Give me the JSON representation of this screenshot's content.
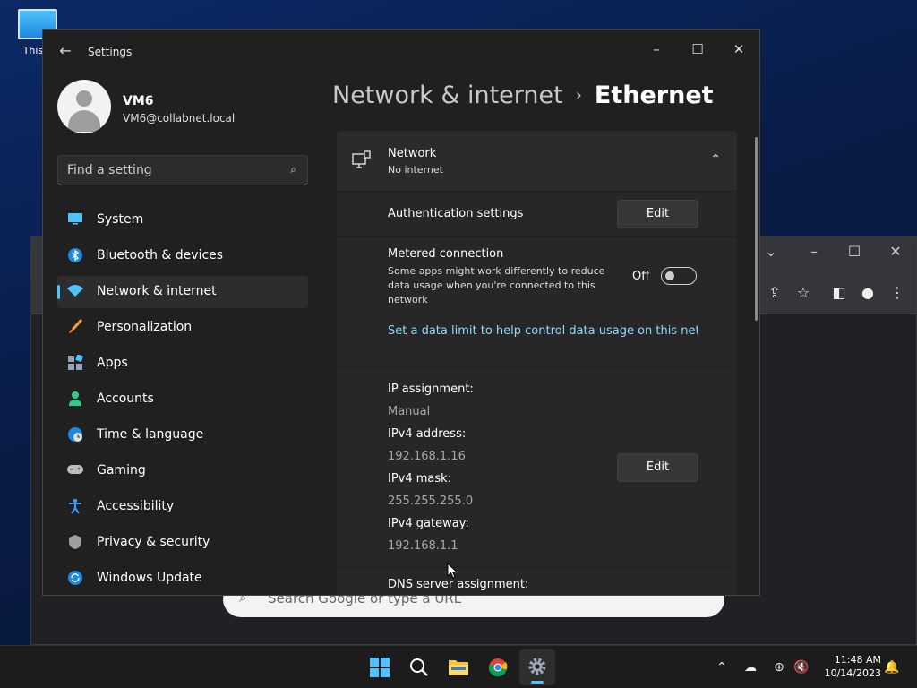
{
  "desktop": {
    "this_pc_label": "This P"
  },
  "browser": {
    "search_placeholder": "Search Google or type a URL"
  },
  "settings": {
    "app_title": "Settings",
    "user": {
      "name": "VM6",
      "email": "VM6@collabnet.local"
    },
    "search_placeholder": "Find a setting",
    "nav_items": [
      {
        "label": "System",
        "icon": "system-icon",
        "selected": false
      },
      {
        "label": "Bluetooth & devices",
        "icon": "bluetooth-icon",
        "selected": false
      },
      {
        "label": "Network & internet",
        "icon": "wifi-icon",
        "selected": true
      },
      {
        "label": "Personalization",
        "icon": "brush-icon",
        "selected": false
      },
      {
        "label": "Apps",
        "icon": "apps-icon",
        "selected": false
      },
      {
        "label": "Accounts",
        "icon": "person-icon",
        "selected": false
      },
      {
        "label": "Time & language",
        "icon": "globe-clock-icon",
        "selected": false
      },
      {
        "label": "Gaming",
        "icon": "gamepad-icon",
        "selected": false
      },
      {
        "label": "Accessibility",
        "icon": "accessibility-icon",
        "selected": false
      },
      {
        "label": "Privacy & security",
        "icon": "shield-icon",
        "selected": false
      },
      {
        "label": "Windows Update",
        "icon": "update-icon",
        "selected": false
      }
    ],
    "breadcrumb": {
      "parent": "Network & internet",
      "separator": "›",
      "current": "Ethernet"
    },
    "network": {
      "title": "Network",
      "status": "No internet"
    },
    "authentication": {
      "label": "Authentication settings",
      "button": "Edit"
    },
    "metered": {
      "title": "Metered connection",
      "description": "Some apps might work differently to reduce data usage when you're connected to this network",
      "state_label": "Off",
      "enabled": false,
      "data_limit_link": "Set a data limit to help control data usage on this netwo"
    },
    "ip": {
      "assignment_label": "IP assignment:",
      "assignment_value": "Manual",
      "ipv4_address_label": "IPv4 address:",
      "ipv4_address_value": "192.168.1.16",
      "ipv4_mask_label": "IPv4 mask:",
      "ipv4_mask_value": "255.255.255.0",
      "ipv4_gateway_label": "IPv4 gateway:",
      "ipv4_gateway_value": "192.168.1.1",
      "edit_button": "Edit"
    },
    "dns": {
      "label": "DNS server assignment:"
    }
  },
  "taskbar": {
    "time": "11:48 AM",
    "date": "10/14/2023"
  },
  "colors": {
    "accent": "#4cc2ff",
    "link": "#8fd8ff",
    "window_bg": "#202020",
    "card_bg": "#2b2b2b"
  }
}
